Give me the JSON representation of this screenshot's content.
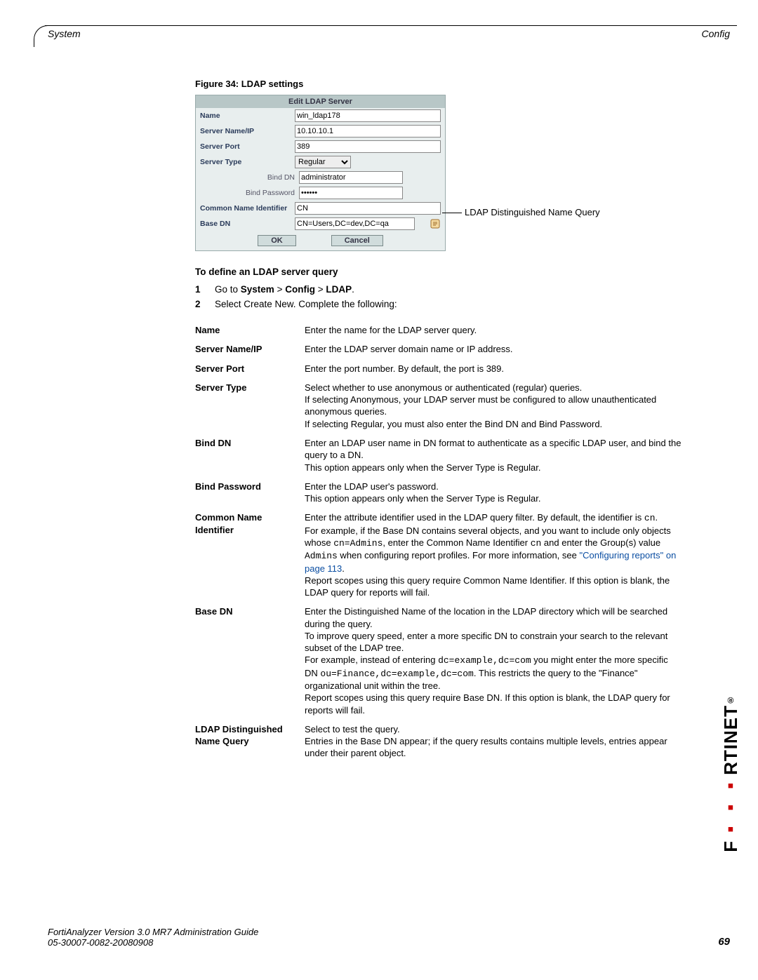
{
  "header": {
    "left": "System",
    "right": "Config"
  },
  "figure": {
    "caption": "Figure 34: LDAP settings",
    "annotation": "LDAP Distinguished Name Query"
  },
  "ldap_panel": {
    "title": "Edit LDAP Server",
    "rows": {
      "name_label": "Name",
      "name_value": "win_ldap178",
      "server_label": "Server Name/IP",
      "server_value": "10.10.10.1",
      "port_label": "Server Port",
      "port_value": "389",
      "type_label": "Server Type",
      "type_value": "Regular",
      "binddn_label": "Bind DN",
      "binddn_value": "administrator",
      "bindpw_label": "Bind Password",
      "bindpw_value": "******",
      "cni_label": "Common Name Identifier",
      "cni_value": "CN",
      "basedn_label": "Base DN",
      "basedn_value": "CN=Users,DC=dev,DC=qa"
    },
    "buttons": {
      "ok": "OK",
      "cancel": "Cancel"
    }
  },
  "subhead": "To define an LDAP server query",
  "steps": [
    {
      "n": "1",
      "pre": "Go to ",
      "b1": "System",
      "sep1": " > ",
      "b2": "Config",
      "sep2": " > ",
      "b3": "LDAP",
      "post": "."
    },
    {
      "n": "2",
      "text": "Select Create New. Complete the following:"
    }
  ],
  "defs": [
    {
      "k": "Name",
      "v": [
        "Enter the name for the LDAP server query."
      ]
    },
    {
      "k": "Server Name/IP",
      "v": [
        "Enter the LDAP server domain name or IP address."
      ]
    },
    {
      "k": "Server Port",
      "v": [
        "Enter the port number. By default, the port is 389."
      ]
    },
    {
      "k": "Server Type",
      "v": [
        "Select whether to use anonymous or authenticated (regular) queries.",
        "If selecting Anonymous, your LDAP server must be configured to allow unauthenticated anonymous queries.",
        "If selecting Regular, you must also enter the Bind DN and Bind Password."
      ]
    },
    {
      "k": "Bind DN",
      "v": [
        "Enter an LDAP user name in DN format to authenticate as a specific LDAP user, and bind the query to a DN.",
        "This option appears only when the Server Type is Regular."
      ]
    },
    {
      "k": "Bind Password",
      "v": [
        "Enter the LDAP user's password.",
        "This option appears only when the Server Type is Regular."
      ]
    },
    {
      "k": "Common Name Identifier",
      "v": [
        "Enter the attribute identifier used in the LDAP query filter. By default, the identifier is <mono>cn</mono>.",
        "For example, if the Base DN contains several objects, and you want to include only objects whose <mono>cn=Admins</mono>, enter the Common Name Identifier <mono>cn</mono> and enter the Group(s) value <mono>Admins</mono> when configuring report profiles. For more information, see <a class='link'>\"Configuring reports\" on page 113</a>.",
        "Report scopes using this query require Common Name Identifier. If this option is blank, the LDAP query for reports will fail."
      ]
    },
    {
      "k": "Base DN",
      "v": [
        "Enter the Distinguished Name of the location in the LDAP directory which will be searched during the query.",
        "To improve query speed, enter a more specific DN to constrain your search to the relevant subset of the LDAP tree.",
        "For example, instead of entering <mono>dc=example,dc=com</mono> you might enter the more specific DN <mono>ou=Finance,dc=example,dc=com</mono>. This restricts the query to the \"Finance\" organizational unit within the tree.",
        "Report scopes using this query require Base DN. If this option is blank, the LDAP query for reports will fail."
      ]
    },
    {
      "k": "LDAP Distinguished Name Query",
      "v": [
        "Select to test the query.",
        "Entries in the Base DN appear; if the query results contains multiple levels, entries appear under their parent object."
      ]
    }
  ],
  "footer": {
    "line1": "FortiAnalyzer Version 3.0 MR7 Administration Guide",
    "line2": "05-30007-0082-20080908",
    "page": "69"
  },
  "brand": "F RTINET"
}
